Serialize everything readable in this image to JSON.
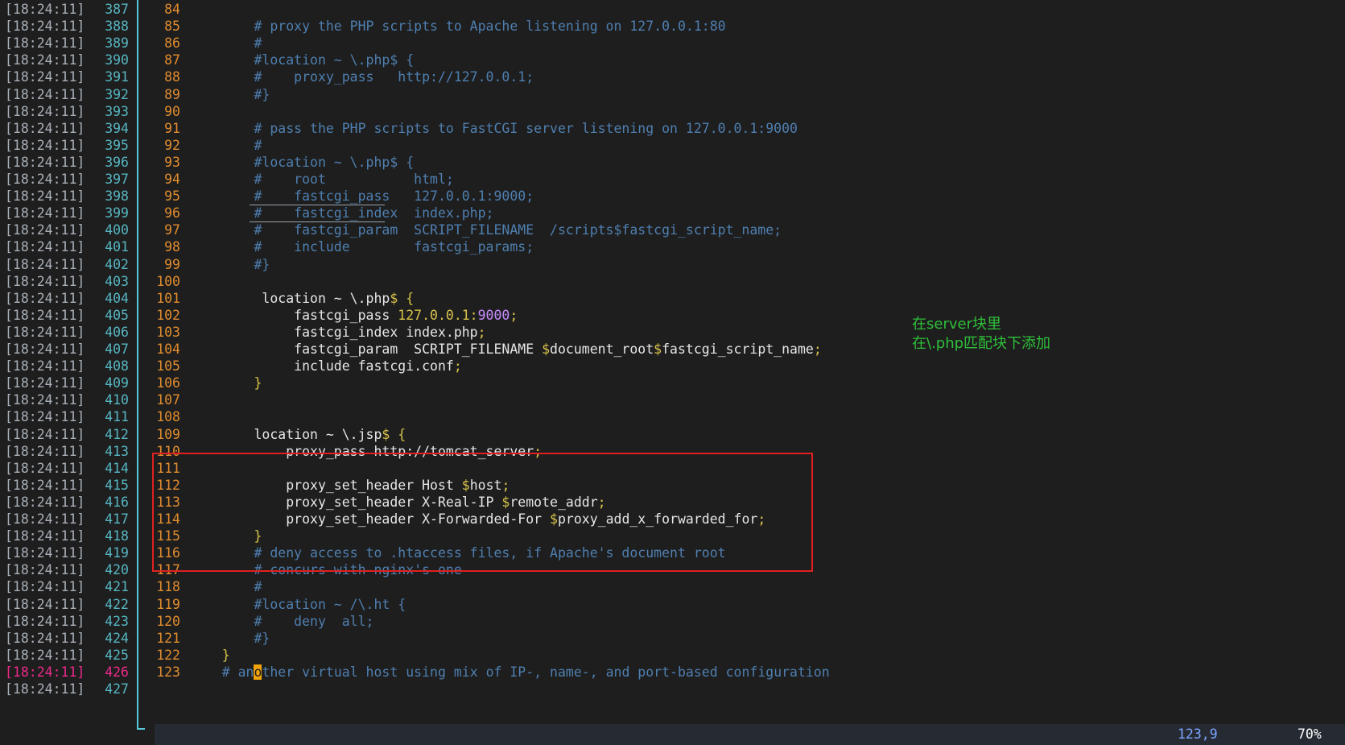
{
  "timestamp": "[18:24:11]",
  "lines": [
    {
      "n": "387",
      "vn": "84",
      "segs": []
    },
    {
      "n": "388",
      "vn": "85",
      "segs": [
        {
          "t": "        # proxy the PHP scripts to Apache listening on 127.0.0.1:80",
          "k": "c"
        }
      ]
    },
    {
      "n": "389",
      "vn": "86",
      "segs": [
        {
          "t": "        #",
          "k": "c"
        }
      ]
    },
    {
      "n": "390",
      "vn": "87",
      "segs": [
        {
          "t": "        #location ~ \\.php$ {",
          "k": "c"
        }
      ]
    },
    {
      "n": "391",
      "vn": "88",
      "segs": [
        {
          "t": "        #    proxy_pass   http://127.0.0.1;",
          "k": "c"
        }
      ]
    },
    {
      "n": "392",
      "vn": "89",
      "segs": [
        {
          "t": "        #}",
          "k": "c"
        }
      ]
    },
    {
      "n": "393",
      "vn": "90",
      "segs": []
    },
    {
      "n": "394",
      "vn": "91",
      "segs": [
        {
          "t": "        # pass the PHP scripts to FastCGI server listening on 127.0.0.1:9000",
          "k": "c"
        }
      ]
    },
    {
      "n": "395",
      "vn": "92",
      "segs": [
        {
          "t": "        #",
          "k": "c"
        }
      ]
    },
    {
      "n": "396",
      "vn": "93",
      "segs": [
        {
          "t": "        #location ~ \\.php$ {",
          "k": "c"
        }
      ]
    },
    {
      "n": "397",
      "vn": "94",
      "segs": [
        {
          "t": "        #    root           html;",
          "k": "c"
        }
      ]
    },
    {
      "n": "398",
      "vn": "95",
      "segs": [
        {
          "t": "        #    fastcgi_pass   127.0.0.1:9000;",
          "k": "c"
        }
      ],
      "ul": 168
    },
    {
      "n": "399",
      "vn": "96",
      "segs": [
        {
          "t": "        #    fastcgi_index  index.php;",
          "k": "c"
        }
      ],
      "ul": 168
    },
    {
      "n": "400",
      "vn": "97",
      "segs": [
        {
          "t": "        #    fastcgi_param  SCRIPT_FILENAME  /scripts$fastcgi_script_name;",
          "k": "c"
        }
      ]
    },
    {
      "n": "401",
      "vn": "98",
      "segs": [
        {
          "t": "        #    include        fastcgi_params;",
          "k": "c"
        }
      ]
    },
    {
      "n": "402",
      "vn": "99",
      "segs": [
        {
          "t": "        #}",
          "k": "c"
        }
      ]
    },
    {
      "n": "403",
      "vn": "100",
      "segs": []
    },
    {
      "n": "404",
      "vn": "101",
      "segs": [
        {
          "t": "         location ~ \\.php",
          "k": "n"
        },
        {
          "t": "$ {",
          "k": "v"
        }
      ]
    },
    {
      "n": "405",
      "vn": "102",
      "segs": [
        {
          "t": "             fastcgi_pass ",
          "k": "n"
        },
        {
          "t": "127.0.0.1:",
          "k": "v"
        },
        {
          "t": "9000",
          "k": "p"
        },
        {
          "t": ";",
          "k": "v"
        }
      ]
    },
    {
      "n": "406",
      "vn": "103",
      "segs": [
        {
          "t": "             fastcgi_index index.php",
          "k": "n"
        },
        {
          "t": ";",
          "k": "v"
        }
      ]
    },
    {
      "n": "407",
      "vn": "104",
      "segs": [
        {
          "t": "             fastcgi_param  SCRIPT_FILENAME ",
          "k": "n"
        },
        {
          "t": "$",
          "k": "v"
        },
        {
          "t": "document_root",
          "k": "n"
        },
        {
          "t": "$",
          "k": "v"
        },
        {
          "t": "fastcgi_script_name",
          "k": "n"
        },
        {
          "t": ";",
          "k": "v"
        }
      ]
    },
    {
      "n": "408",
      "vn": "105",
      "segs": [
        {
          "t": "             include fastcgi.conf",
          "k": "n"
        },
        {
          "t": ";",
          "k": "v"
        }
      ]
    },
    {
      "n": "409",
      "vn": "106",
      "segs": [
        {
          "t": "        }",
          "k": "v"
        }
      ]
    },
    {
      "n": "410",
      "vn": "107",
      "segs": []
    },
    {
      "n": "411",
      "vn": "108",
      "segs": []
    },
    {
      "n": "412",
      "vn": "109",
      "segs": [
        {
          "t": "        location ~ \\.jsp",
          "k": "n"
        },
        {
          "t": "$ {",
          "k": "v"
        }
      ]
    },
    {
      "n": "413",
      "vn": "110",
      "segs": [
        {
          "t": "            proxy_pass http://tomcat_server",
          "k": "n"
        },
        {
          "t": ";",
          "k": "v"
        }
      ]
    },
    {
      "n": "414",
      "vn": "111",
      "segs": []
    },
    {
      "n": "415",
      "vn": "112",
      "segs": [
        {
          "t": "            proxy_set_header Host ",
          "k": "n"
        },
        {
          "t": "$",
          "k": "v"
        },
        {
          "t": "host",
          "k": "n"
        },
        {
          "t": ";",
          "k": "v"
        }
      ]
    },
    {
      "n": "416",
      "vn": "113",
      "segs": [
        {
          "t": "            proxy_set_header X-Real-IP ",
          "k": "n"
        },
        {
          "t": "$",
          "k": "v"
        },
        {
          "t": "remote_addr",
          "k": "n"
        },
        {
          "t": ";",
          "k": "v"
        }
      ]
    },
    {
      "n": "417",
      "vn": "114",
      "segs": [
        {
          "t": "            proxy_set_header X-Forwarded-For ",
          "k": "n"
        },
        {
          "t": "$",
          "k": "v"
        },
        {
          "t": "proxy_add_x_forwarded_for",
          "k": "n"
        },
        {
          "t": ";",
          "k": "v"
        }
      ]
    },
    {
      "n": "418",
      "vn": "115",
      "segs": [
        {
          "t": "        }",
          "k": "v"
        }
      ]
    },
    {
      "n": "419",
      "vn": "116",
      "segs": [
        {
          "t": "        # deny access to .htaccess files, if Apache's document root",
          "k": "c"
        }
      ]
    },
    {
      "n": "420",
      "vn": "117",
      "segs": [
        {
          "t": "        # concurs with nginx's one",
          "k": "c"
        }
      ]
    },
    {
      "n": "421",
      "vn": "118",
      "segs": [
        {
          "t": "        #",
          "k": "c"
        }
      ]
    },
    {
      "n": "422",
      "vn": "119",
      "segs": [
        {
          "t": "        #location ~ /\\.ht {",
          "k": "c"
        }
      ]
    },
    {
      "n": "423",
      "vn": "120",
      "segs": [
        {
          "t": "        #    deny  all;",
          "k": "c"
        }
      ]
    },
    {
      "n": "424",
      "vn": "121",
      "segs": [
        {
          "t": "        #}",
          "k": "c"
        }
      ]
    },
    {
      "n": "425",
      "vn": "122",
      "segs": [
        {
          "t": "    }",
          "k": "v"
        }
      ]
    },
    {
      "n": "426",
      "vn": "123",
      "cur": true,
      "segs": [
        {
          "t": "    # an",
          "k": "c"
        },
        {
          "t": "o",
          "k": "cursor"
        },
        {
          "t": "ther virtual host using mix of IP-, name-, and port-based configuration",
          "k": "c"
        }
      ]
    },
    {
      "n": "427",
      "vn": "",
      "segs": []
    }
  ],
  "annotation": [
    "在server块里",
    "在\\.php匹配块下添加"
  ],
  "status": {
    "position": "123,9",
    "percent": "70%"
  },
  "colors": {
    "background": "#1e1e1e",
    "comment": "#4f7fb0",
    "keyword": "#d8c24a",
    "number": "#c78bff",
    "highlight_box": "#e02020",
    "annotation": "#2fbf3a",
    "current_line": "#ec2a8a"
  }
}
